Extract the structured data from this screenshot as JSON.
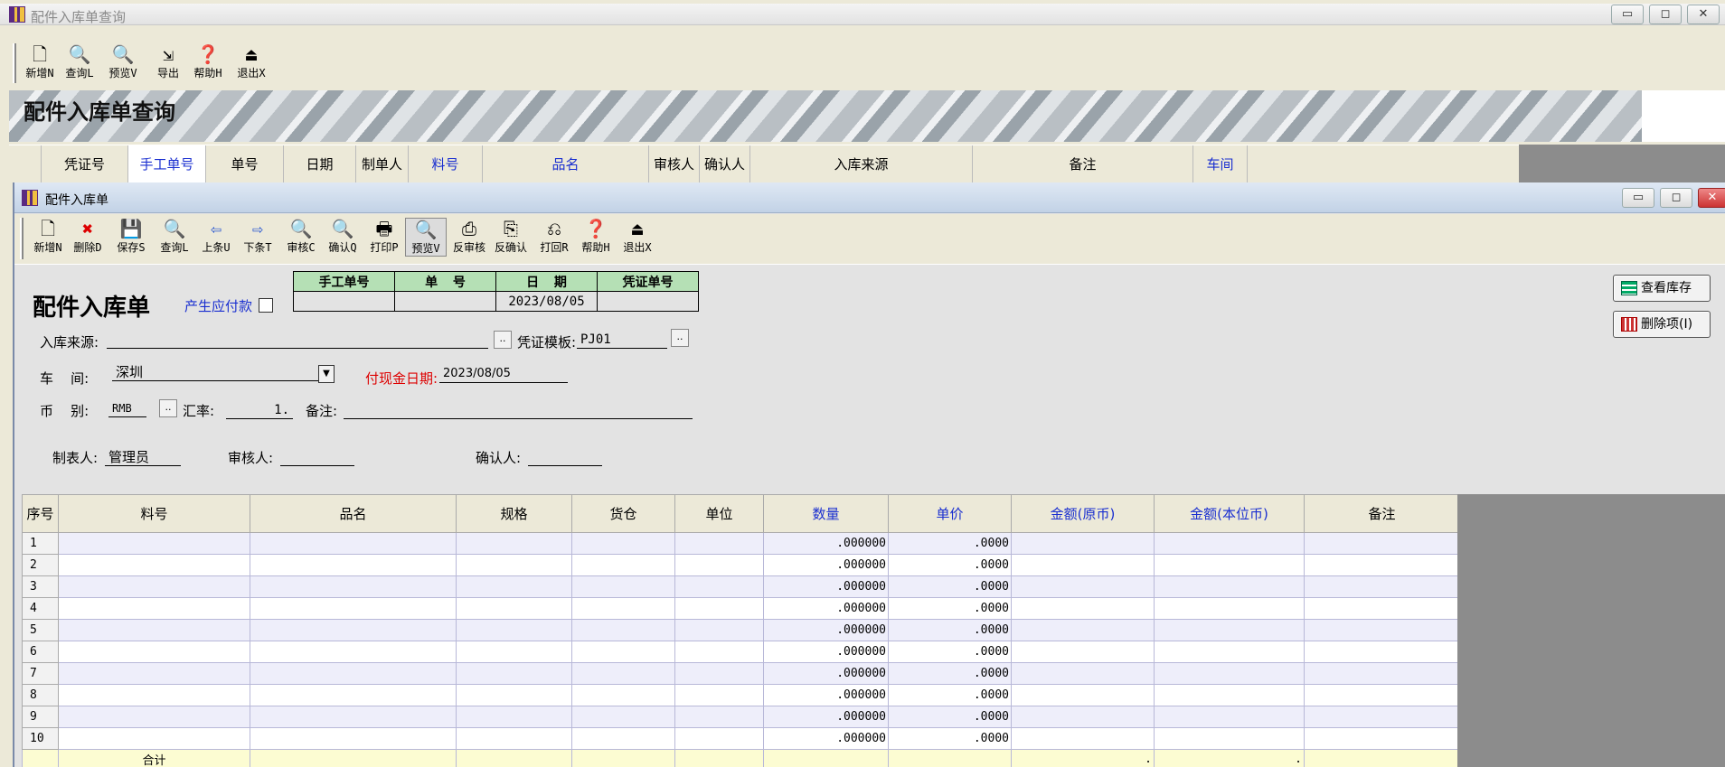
{
  "outer_window": {
    "title": "配件入库单查询",
    "toolbar": [
      {
        "label": "新增N",
        "icon": "new-doc-icon"
      },
      {
        "label": "查询L",
        "icon": "query-icon"
      },
      {
        "label": "预览V",
        "icon": "preview-icon"
      },
      {
        "label": "导出",
        "icon": "export-icon"
      },
      {
        "label": "帮助H",
        "icon": "help-icon"
      },
      {
        "label": "退出X",
        "icon": "exit-icon"
      }
    ],
    "banner_title": "配件入库单查询",
    "query_columns": [
      {
        "label": "凭证号",
        "blue": false
      },
      {
        "label": "手工单号",
        "blue": true
      },
      {
        "label": "单号",
        "blue": false
      },
      {
        "label": "日期",
        "blue": false
      },
      {
        "label": "制单人",
        "blue": false
      },
      {
        "label": "料号",
        "blue": true
      },
      {
        "label": "品名",
        "blue": true
      },
      {
        "label": "审核人",
        "blue": false
      },
      {
        "label": "确认人",
        "blue": false
      },
      {
        "label": "入库来源",
        "blue": false
      },
      {
        "label": "备注",
        "blue": false
      },
      {
        "label": "车间",
        "blue": true
      }
    ]
  },
  "inner_window": {
    "title": "配件入库单",
    "toolbar": [
      {
        "label": "新增N",
        "icon": "new-doc-icon"
      },
      {
        "label": "删除D",
        "icon": "delete-icon"
      },
      {
        "label": "保存S",
        "icon": "save-icon"
      },
      {
        "label": "查询L",
        "icon": "query-icon"
      },
      {
        "label": "上条U",
        "icon": "arrow-left-icon"
      },
      {
        "label": "下条T",
        "icon": "arrow-right-icon"
      },
      {
        "label": "审核C",
        "icon": "approve-icon"
      },
      {
        "label": "确认Q",
        "icon": "confirm-icon"
      },
      {
        "label": "打印P",
        "icon": "print-icon"
      },
      {
        "label": "预览V",
        "icon": "preview-icon"
      },
      {
        "label": "反审核",
        "icon": "unapprove-icon"
      },
      {
        "label": "反确认",
        "icon": "unconfirm-icon"
      },
      {
        "label": "打回R",
        "icon": "reject-icon"
      },
      {
        "label": "帮助H",
        "icon": "help-icon"
      },
      {
        "label": "退出X",
        "icon": "exit-icon"
      }
    ],
    "form": {
      "heading": "配件入库单",
      "payable_label": "产生应付款",
      "header_table": {
        "headers": [
          "手工单号",
          "单  号",
          "日  期",
          "凭证单号"
        ],
        "values": [
          "",
          "",
          "2023/08/05",
          ""
        ]
      },
      "source_label": "入库来源:",
      "source_value": "",
      "voucher_template_label": "凭证模板:",
      "voucher_template_value": "PJ01",
      "workshop_label": "车    间:",
      "workshop_value": "深圳",
      "pay_date_label": "付现金日期:",
      "pay_date_value": "2023/08/05",
      "currency_label": "币    别:",
      "currency_value": "RMB",
      "rate_label": "汇率:",
      "rate_value": "1.",
      "remark_label": "备注:",
      "remark_value": "",
      "creator_label": "制表人:",
      "creator_value": "管理员",
      "reviewer_label": "审核人:",
      "reviewer_value": "",
      "confirmer_label": "确认人:",
      "confirmer_value": "",
      "view_stock_button": "查看库存",
      "delete_item_button": "删除项(I)"
    },
    "grid": {
      "columns": [
        {
          "label": "序号",
          "blue": false
        },
        {
          "label": "料号",
          "blue": false
        },
        {
          "label": "品名",
          "blue": false
        },
        {
          "label": "规格",
          "blue": false
        },
        {
          "label": "货仓",
          "blue": false
        },
        {
          "label": "单位",
          "blue": false
        },
        {
          "label": "数量",
          "blue": true
        },
        {
          "label": "单价",
          "blue": true
        },
        {
          "label": "金额(原币)",
          "blue": true
        },
        {
          "label": "金额(本位币)",
          "blue": true
        },
        {
          "label": "备注",
          "blue": false
        }
      ],
      "rows": [
        {
          "no": "1",
          "qty": ".000000",
          "price": ".0000"
        },
        {
          "no": "2",
          "qty": ".000000",
          "price": ".0000"
        },
        {
          "no": "3",
          "qty": ".000000",
          "price": ".0000"
        },
        {
          "no": "4",
          "qty": ".000000",
          "price": ".0000"
        },
        {
          "no": "5",
          "qty": ".000000",
          "price": ".0000"
        },
        {
          "no": "6",
          "qty": ".000000",
          "price": ".0000"
        },
        {
          "no": "7",
          "qty": ".000000",
          "price": ".0000"
        },
        {
          "no": "8",
          "qty": ".000000",
          "price": ".0000"
        },
        {
          "no": "9",
          "qty": ".000000",
          "price": ".0000"
        },
        {
          "no": "10",
          "qty": ".000000",
          "price": ".0000"
        }
      ],
      "total_label": "合计",
      "total_amount": ".",
      "total_amount_base": "."
    }
  }
}
